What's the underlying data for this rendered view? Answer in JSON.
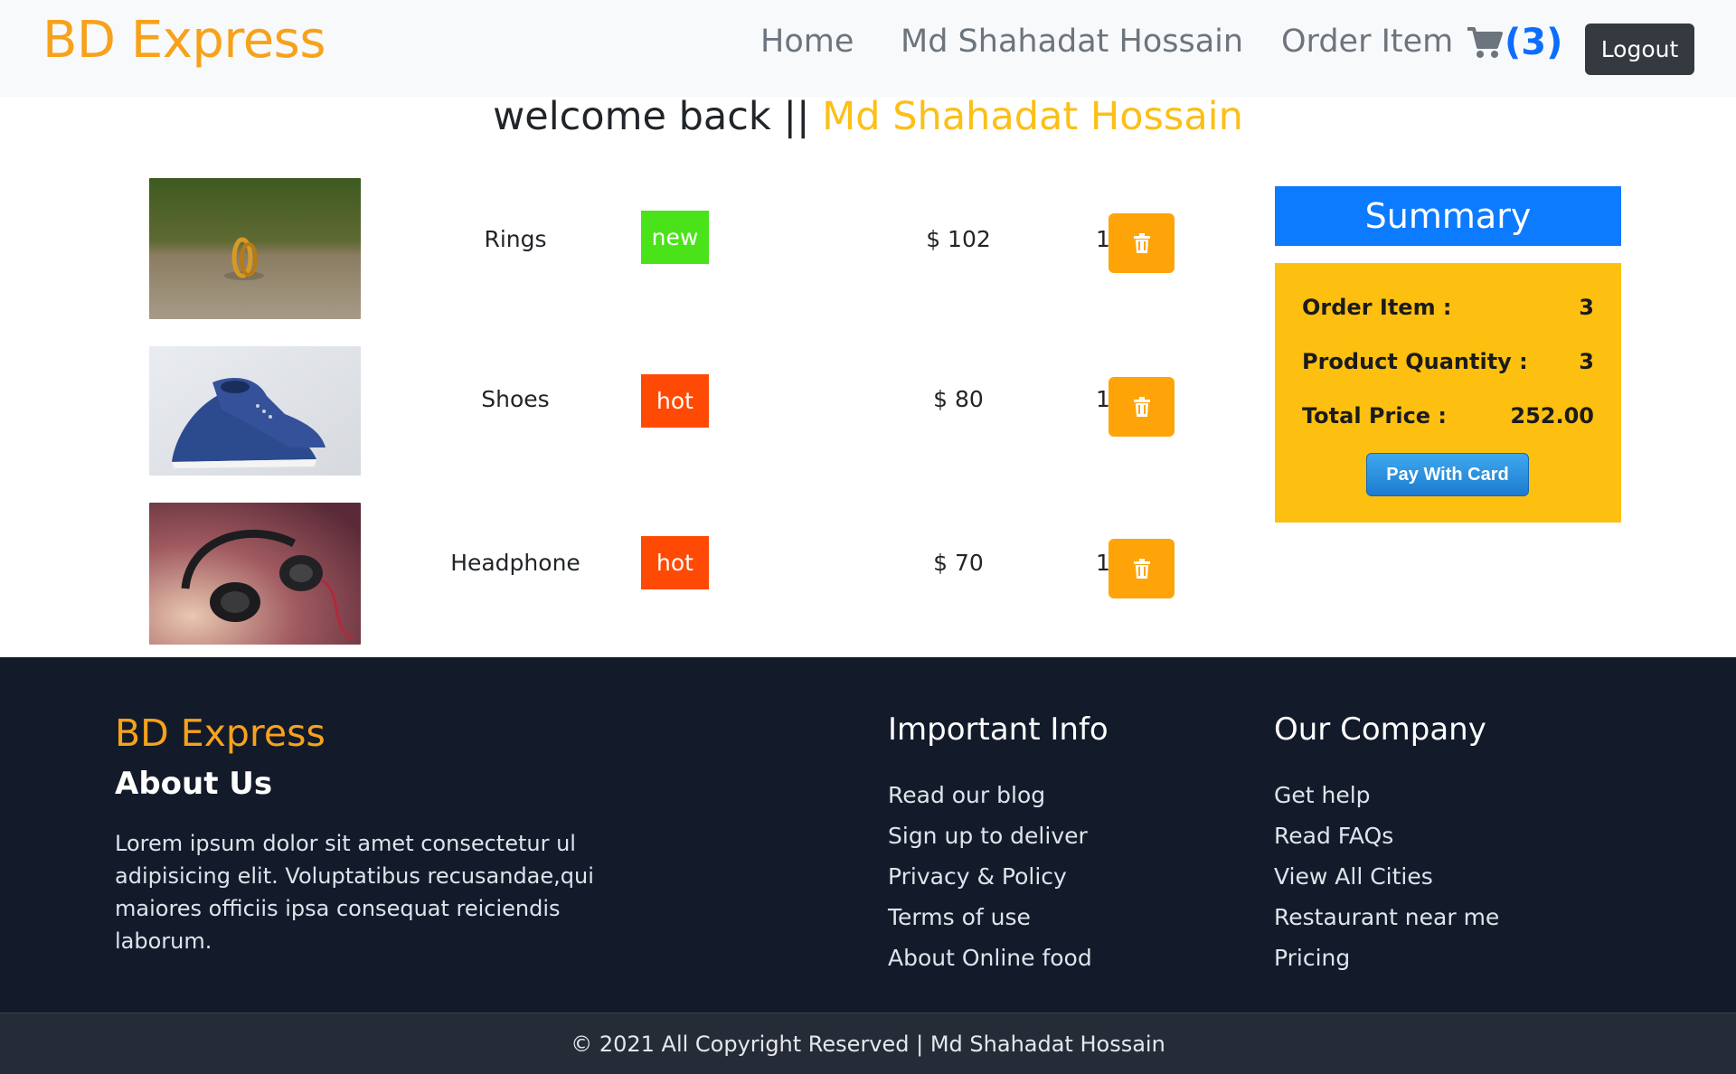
{
  "navbar": {
    "brand": "BD Express",
    "home": "Home",
    "user": "Md Shahadat Hossain",
    "order_item": "Order Item",
    "cart_count": "(3)",
    "logout": "Logout"
  },
  "welcome": {
    "prefix": "welcome back ||",
    "user": "Md Shahadat Hossain"
  },
  "cart": {
    "items": [
      {
        "name": "Rings",
        "badge": "new",
        "badge_color": "#4ae319",
        "price": "$ 102",
        "qty": "1"
      },
      {
        "name": "Shoes",
        "badge": "hot",
        "badge_color": "#ff4a05",
        "price": "$ 80",
        "qty": "1"
      },
      {
        "name": "Headphone",
        "badge": "hot",
        "badge_color": "#ff4a05",
        "price": "$ 70",
        "qty": "1"
      }
    ]
  },
  "summary": {
    "title": "Summary",
    "order_item_label": "Order Item :",
    "order_item_value": "3",
    "quantity_label": "Product Quantity :",
    "quantity_value": "3",
    "total_label": "Total Price :",
    "total_value": "252.00",
    "pay_button": "Pay With Card"
  },
  "footer": {
    "brand": "BD Express",
    "about_title": "About Us",
    "about_text": "Lorem ipsum dolor sit amet consectetur ul adipisicing elit. Voluptatibus recusandae,qui maiores officiis ipsa consequat reiciendis laborum.",
    "info_title": "Important Info",
    "info_links": [
      "Read our blog",
      "Sign up to deliver",
      "Privacy & Policy",
      "Terms of use",
      "About Online food"
    ],
    "company_title": "Our Company",
    "company_links": [
      "Get help",
      "Read FAQs",
      "View All Cities",
      "Restaurant near me",
      "Pricing"
    ],
    "copyright": "© 2021 All Copyright Reserved | Md Shahadat Hossain"
  },
  "colors": {
    "brand": "#f7a21b",
    "accent_blue": "#0d7bff",
    "summary_bg": "#fdc010",
    "delete_button": "#ffa408",
    "footer_bg": "#131b2b"
  }
}
